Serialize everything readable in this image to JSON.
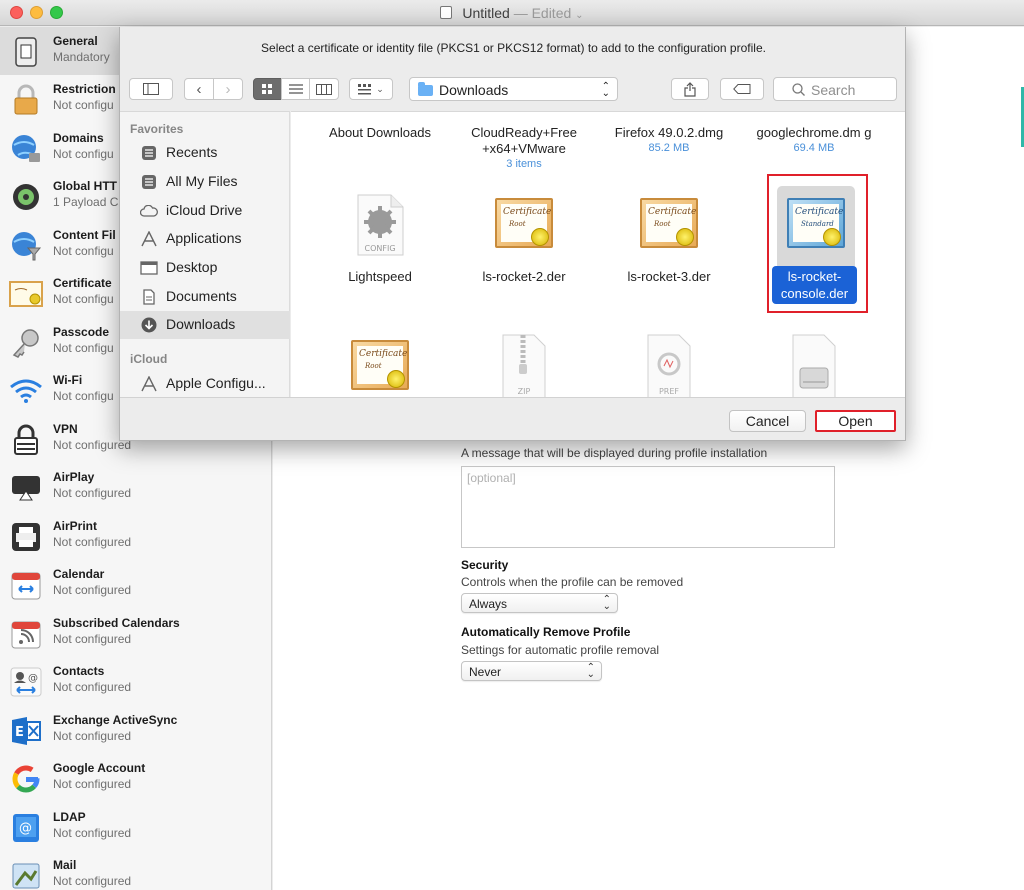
{
  "window": {
    "title": "Untitled",
    "edited": "— Edited"
  },
  "sidebar": {
    "items": [
      {
        "title": "General",
        "subtitle": "Mandatory",
        "icon": "general-icon"
      },
      {
        "title": "Restriction",
        "subtitle": "Not configu",
        "icon": "lock-icon"
      },
      {
        "title": "Domains",
        "subtitle": "Not configu",
        "icon": "globe-lock-icon"
      },
      {
        "title": "Global HTT",
        "subtitle": "1 Payload C",
        "icon": "proxy-icon"
      },
      {
        "title": "Content Fil",
        "subtitle": "Not configu",
        "icon": "filter-globe-icon"
      },
      {
        "title": "Certificate",
        "subtitle": "Not configu",
        "icon": "certificate-icon"
      },
      {
        "title": "Passcode",
        "subtitle": "Not configu",
        "icon": "key-icon"
      },
      {
        "title": "Wi-Fi",
        "subtitle": "Not configu",
        "icon": "wifi-icon"
      },
      {
        "title": "VPN",
        "subtitle": "Not configured",
        "icon": "vpn-lock-icon"
      },
      {
        "title": "AirPlay",
        "subtitle": "Not configured",
        "icon": "airplay-icon"
      },
      {
        "title": "AirPrint",
        "subtitle": "Not configured",
        "icon": "printer-icon"
      },
      {
        "title": "Calendar",
        "subtitle": "Not configured",
        "icon": "calendar-icon"
      },
      {
        "title": "Subscribed Calendars",
        "subtitle": "Not configured",
        "icon": "subscribed-calendar-icon"
      },
      {
        "title": "Contacts",
        "subtitle": "Not configured",
        "icon": "contacts-icon"
      },
      {
        "title": "Exchange ActiveSync",
        "subtitle": "Not configured",
        "icon": "exchange-icon"
      },
      {
        "title": "Google Account",
        "subtitle": "Not configured",
        "icon": "google-icon"
      },
      {
        "title": "LDAP",
        "subtitle": "Not configured",
        "icon": "ldap-icon"
      },
      {
        "title": "Mail",
        "subtitle": "Not configured",
        "icon": "mail-icon"
      }
    ]
  },
  "main": {
    "consent_desc": "A message that will be displayed during profile installation",
    "consent_placeholder": "[optional]",
    "security": {
      "title": "Security",
      "desc": "Controls when the profile can be removed",
      "value": "Always"
    },
    "auto_remove": {
      "title": "Automatically Remove Profile",
      "desc": "Settings for automatic profile removal",
      "value": "Never"
    }
  },
  "dialog": {
    "message": "Select a certificate or identity file (PKCS1 or PKCS12 format) to add to the configuration profile.",
    "location": "Downloads",
    "search_placeholder": "Search",
    "favorites_header": "Favorites",
    "favorites": [
      {
        "label": "Recents",
        "icon": "recents-icon"
      },
      {
        "label": "All My Files",
        "icon": "all-files-icon"
      },
      {
        "label": "iCloud Drive",
        "icon": "cloud-icon"
      },
      {
        "label": "Applications",
        "icon": "applications-icon"
      },
      {
        "label": "Desktop",
        "icon": "desktop-icon"
      },
      {
        "label": "Documents",
        "icon": "documents-icon"
      },
      {
        "label": "Downloads",
        "icon": "downloads-icon"
      }
    ],
    "icloud_header": "iCloud",
    "icloud_items": [
      {
        "label": "Apple Configu...",
        "icon": "apple-configurator-icon"
      }
    ],
    "files": [
      {
        "name": "About Downloads",
        "meta": ""
      },
      {
        "name": "CloudReady+Free +x64+VMware",
        "meta": "3 items"
      },
      {
        "name": "Firefox 49.0.2.dmg",
        "meta": "85.2 MB"
      },
      {
        "name": "googlechrome.dm g",
        "meta": "69.4 MB"
      },
      {
        "name": "Lightspeed",
        "meta": ""
      },
      {
        "name": "ls-rocket-2.der",
        "meta": ""
      },
      {
        "name": "ls-rocket-3.der",
        "meta": ""
      },
      {
        "name": "ls-rocket- console.der",
        "meta": ""
      }
    ],
    "icon_labels": {
      "config": "CONFIG",
      "zip": "ZIP",
      "pref": "PREF",
      "cert_script": "Certificate",
      "cert_root": "Root",
      "cert_standard": "Standard"
    },
    "cancel_label": "Cancel",
    "open_label": "Open"
  },
  "colors": {
    "selection": "#1b62d6",
    "highlight": "#e0202a",
    "accent_blue": "#4a90d9"
  }
}
